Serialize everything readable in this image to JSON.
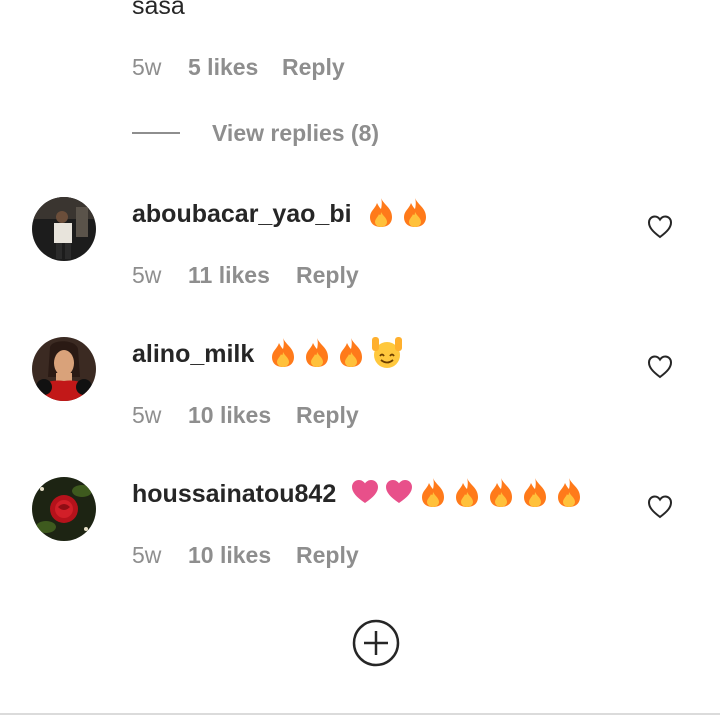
{
  "top_comment": {
    "text_fragment": "sasa",
    "time": "5w",
    "likes": "5 likes",
    "reply": "Reply",
    "view_replies": "View replies (8)"
  },
  "comments": [
    {
      "username": "aboubacar_yao_bi",
      "emojis": [
        "fire",
        "fire"
      ],
      "time": "5w",
      "likes": "11 likes",
      "reply": "Reply"
    },
    {
      "username": "alino_milk",
      "emojis": [
        "fire",
        "fire",
        "fire",
        "raising-hands"
      ],
      "time": "5w",
      "likes": "10 likes",
      "reply": "Reply"
    },
    {
      "username": "houssainatou842",
      "emojis": [
        "heart",
        "heart",
        "fire",
        "fire",
        "fire",
        "fire",
        "fire"
      ],
      "time": "5w",
      "likes": "10 likes",
      "reply": "Reply"
    }
  ],
  "colors": {
    "text": "#262626",
    "muted": "#8e8e8e",
    "fire": "#ff7a1a",
    "heart": "#e8508a"
  },
  "icons": {
    "like": "heart-outline-icon",
    "add": "plus-circle-icon"
  }
}
